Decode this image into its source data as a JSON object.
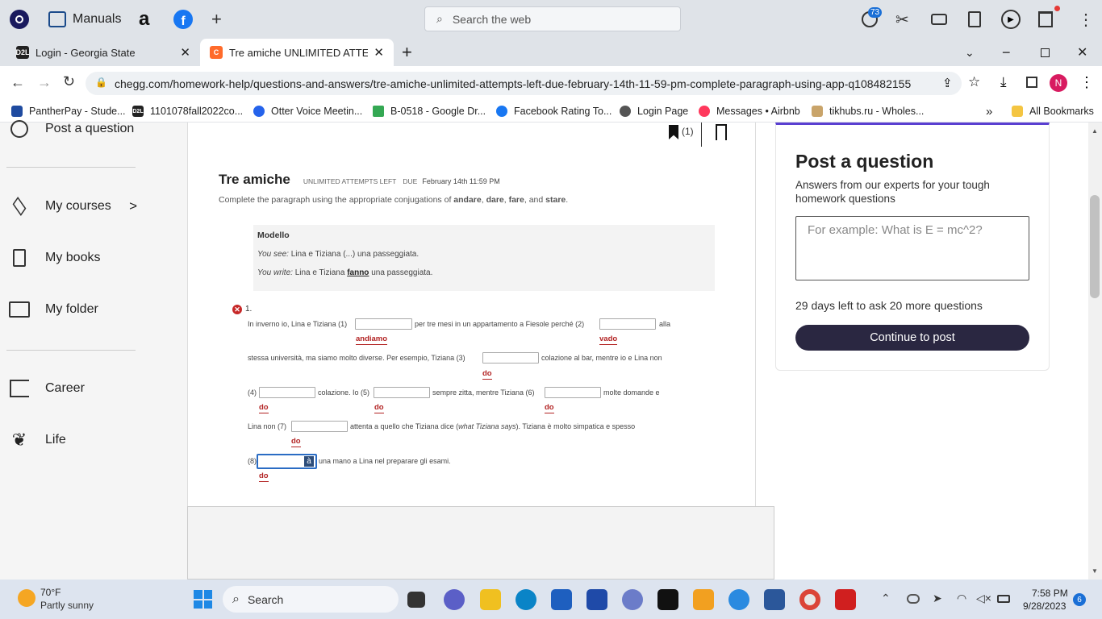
{
  "os_bar": {
    "manuals_label": "Manuals",
    "web_search_placeholder": "Search the web",
    "notification_badge": "73"
  },
  "tabs": [
    {
      "label": "Login - Georgia State",
      "icon": "d2l-icon",
      "favicon_text": "D2L"
    },
    {
      "label": "Tre amiche UNLIMITED ATTEMPTS",
      "icon": "chegg-icon",
      "favicon_text": "C"
    }
  ],
  "address": {
    "url": "chegg.com/homework-help/questions-and-answers/tre-amiche-unlimited-attempts-left-due-february-14th-11-59-pm-complete-paragraph-using-app-q108482155",
    "profile_initial": "N"
  },
  "bookmarks": [
    {
      "label": "PantherPay - Stude...",
      "icon": "panther-icon"
    },
    {
      "label": "1101078fall2022co...",
      "icon": "d2l-icon",
      "favicon_text": "D2L"
    },
    {
      "label": "Otter Voice Meetin...",
      "icon": "otter-icon"
    },
    {
      "label": "B-0518 - Google Dr...",
      "icon": "google-drive-icon"
    },
    {
      "label": "Facebook Rating To...",
      "icon": "facebook-icon"
    },
    {
      "label": "Login Page",
      "icon": "login-icon"
    },
    {
      "label": "Messages • Airbnb",
      "icon": "airbnb-icon"
    },
    {
      "label": "tikhubs.ru - Wholes...",
      "icon": "tikhubs-icon"
    }
  ],
  "bookmarks_more": "»",
  "all_bookmarks": "All Bookmarks",
  "sidebar": {
    "post_question": "Post a question",
    "items": [
      {
        "label": "My courses",
        "icon": "layers-icon",
        "chevron": ">"
      },
      {
        "label": "My books",
        "icon": "book-icon"
      },
      {
        "label": "My folder",
        "icon": "folder-icon"
      },
      {
        "label": "Career",
        "icon": "career-icon"
      },
      {
        "label": "Life",
        "icon": "plant-icon"
      }
    ]
  },
  "question": {
    "bookmark_count": "(1)",
    "title": "Tre amiche",
    "unlimited": "UNLIMITED ATTEMPTS LEFT",
    "due_label": "DUE",
    "due_date": "February 14th 11:59 PM",
    "instruction_pre": "Complete the paragraph using the appropriate conjugations of ",
    "verbs": [
      "andare",
      "dare",
      "fare",
      "stare"
    ],
    "instruction_and": "and",
    "model": {
      "heading": "Modello",
      "you_see_label": "You see:",
      "you_see_text": "Lina e Tiziana (...) una passeggiata.",
      "you_write_label": "You write:",
      "you_write_pre": "Lina e Tiziana",
      "you_write_bold": "fanno",
      "you_write_post": "una passeggiata."
    },
    "item_number": "1.",
    "lines": {
      "l1a": "In inverno io, Lina e Tiziana (1)",
      "l1b": "per tre mesi in un appartamento a Fiesole perché (2)",
      "l1c": "alla",
      "l2a": "stessa università, ma siamo molto diverse. Per esempio, Tiziana (3)",
      "l2b": "colazione al bar, mentre io e Lina non",
      "l3a": "(4)",
      "l3b": "colazione. Io (5)",
      "l3c": "sempre zitta, mentre Tiziana (6)",
      "l3d": "molte domande e",
      "l4a": "Lina non (7)",
      "l4b": "attenta a quello che Tiziana dice (",
      "l4c": "what Tiziana says",
      "l4d": "). Tiziana è molto simpatica e spesso",
      "l5a": "(8)",
      "l5b": "una mano a Lina nel preparare gli esami."
    },
    "answers": [
      "andiamo",
      "vado",
      "do",
      "do",
      "do",
      "do",
      "do",
      "do"
    ],
    "accent_button": "à"
  },
  "post_card": {
    "title": "Post a question",
    "subtitle": "Answers from our experts for your tough homework questions",
    "placeholder": "For example: What is E = mc^2?",
    "days_left": "29 days left to ask 20 more questions",
    "button": "Continue to post"
  },
  "taskbar": {
    "weather_temp": "70°F",
    "weather_desc": "Partly sunny",
    "search_label": "Search",
    "time": "7:58 PM",
    "date": "9/28/2023",
    "notif_count": "6"
  }
}
